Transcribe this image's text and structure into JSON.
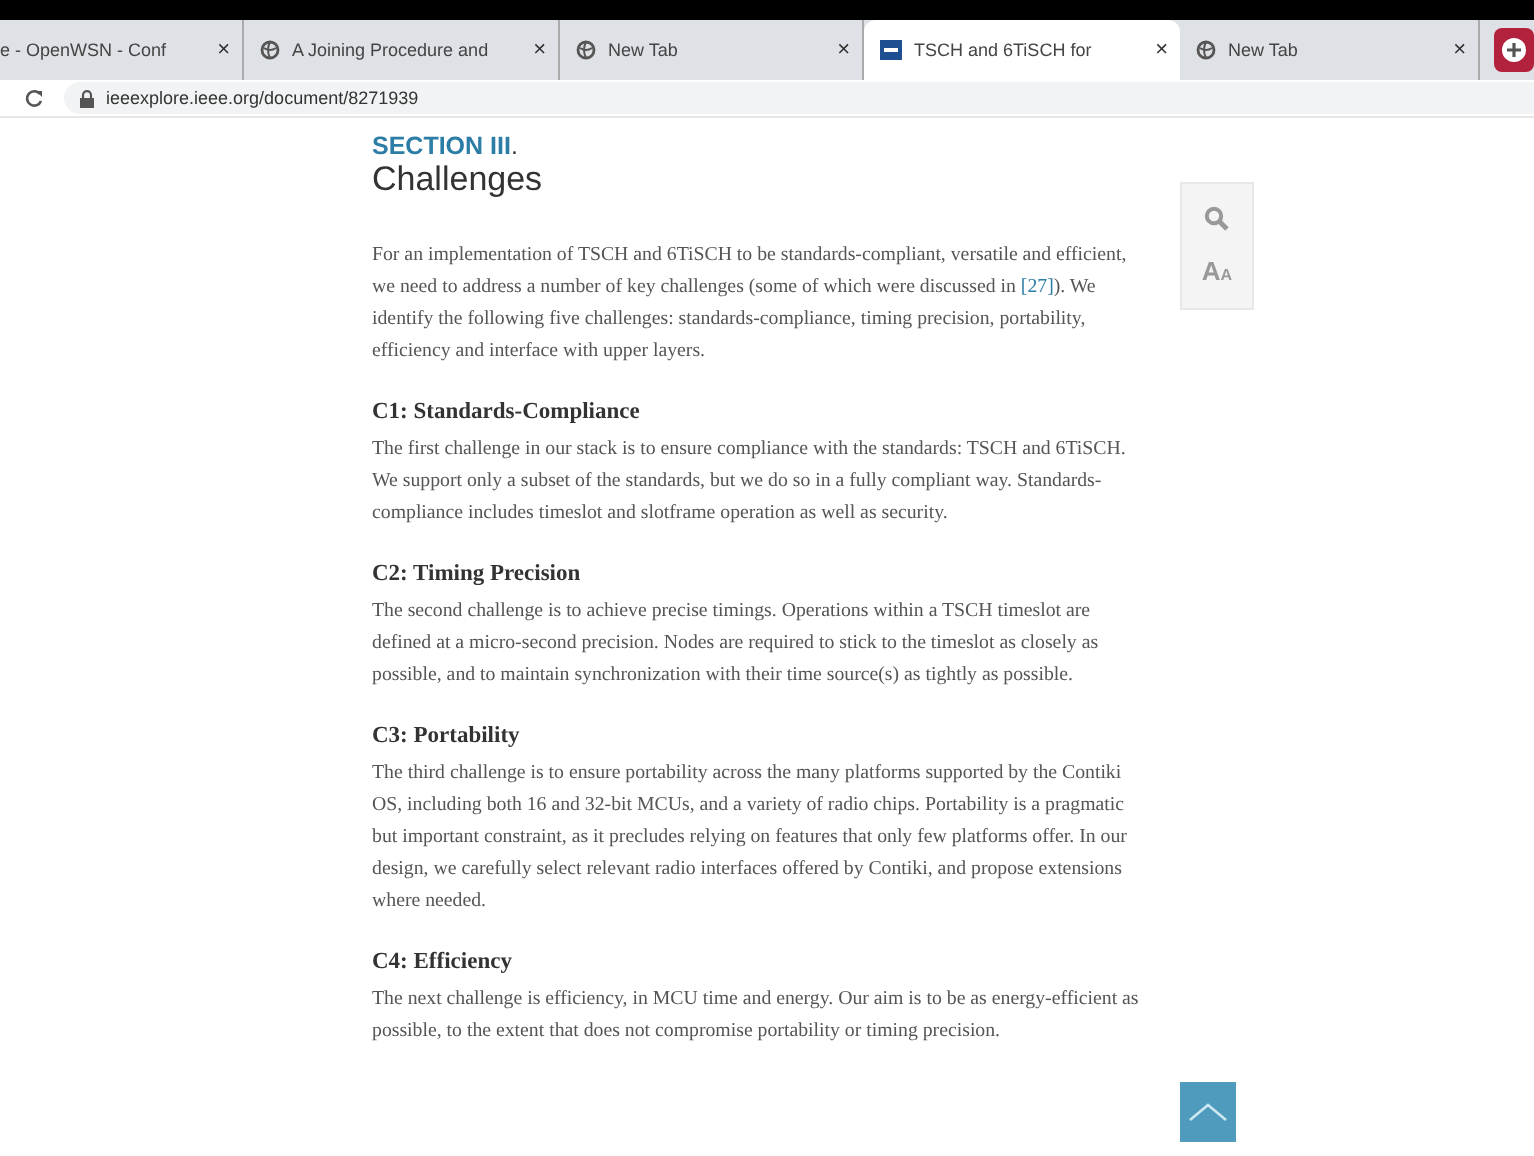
{
  "tabs": [
    {
      "title": "e - OpenWSN - Conf",
      "kind": "plain",
      "selected": false
    },
    {
      "title": "A Joining Procedure and",
      "kind": "web",
      "selected": false
    },
    {
      "title": "New Tab",
      "kind": "web",
      "selected": false
    },
    {
      "title": "TSCH and 6TiSCH for",
      "kind": "ieee",
      "selected": true
    },
    {
      "title": "New Tab",
      "kind": "web",
      "selected": false
    }
  ],
  "tab_close": "×",
  "new_tab_highlighted": true,
  "address_bar": {
    "url": "ieeexplore.ieee.org/document/8271939"
  },
  "article": {
    "section_label": "SECTION III",
    "section_dot": ".",
    "title": "Challenges",
    "intro": {
      "before": "For an implementation of TSCH and 6TiSCH to be standards-compliant, versatile and efficient, we need to address a number of key challenges (some of which were discussed in ",
      "link": "[27]",
      "after": "). We identify the following five challenges: standards-compliance, timing precision, portability, efficiency and interface with upper layers."
    },
    "subsections": [
      {
        "heading": "C1: Standards-Compliance",
        "text": "The first challenge in our stack is to ensure compliance with the standards: TSCH and 6TiSCH. We support only a subset of the standards, but we do so in a fully compliant way. Standards-compliance includes timeslot and slotframe operation as well as security."
      },
      {
        "heading": "C2: Timing Precision",
        "text": "The second challenge is to achieve precise timings. Operations within a TSCH timeslot are defined at a micro-second precision. Nodes are required to stick to the timeslot as closely as possible, and to maintain synchronization with their time source(s) as tightly as possible."
      },
      {
        "heading": "C3: Portability",
        "text": "The third challenge is to ensure portability across the many platforms supported by the Contiki OS, including both 16 and 32-bit MCUs, and a variety of radio chips. Portability is a pragmatic but important constraint, as it precludes relying on features that only few platforms offer. In our design, we carefully select relevant radio interfaces offered by Contiki, and propose extensions where needed."
      },
      {
        "heading": "C4: Efficiency",
        "text": "The next challenge is efficiency, in MCU time and energy. Our aim is to be as energy-efficient as possible, to the extent that does not compromise portability or timing precision."
      }
    ]
  },
  "font_size_button": {
    "large": "A",
    "small": "A"
  }
}
